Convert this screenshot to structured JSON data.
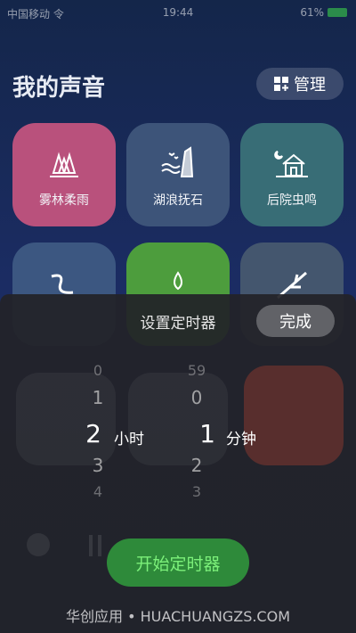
{
  "status": {
    "carrier": "中国移动 令",
    "time": "19:44",
    "battery": "61%"
  },
  "page": {
    "title": "我的声音",
    "manage_label": "管理"
  },
  "tiles": [
    {
      "label": "雾林柔雨",
      "icon": "forest-rain-icon",
      "color": "#b9517c"
    },
    {
      "label": "湖浪抚石",
      "icon": "lake-waves-icon",
      "color": "#3d5479"
    },
    {
      "label": "后院虫鸣",
      "icon": "backyard-house-icon",
      "color": "#386d76"
    },
    {
      "label": "",
      "icon": "river-icon",
      "color": "#3c5781"
    },
    {
      "label": "",
      "icon": "water-drop-icon",
      "color": "#4d9d3d"
    },
    {
      "label": "",
      "icon": "branch-icon",
      "color": "#44566e"
    }
  ],
  "timer": {
    "title": "设置定时器",
    "done_label": "完成",
    "hours": {
      "above2": "0",
      "above1": "1",
      "selected": "2",
      "below1": "3",
      "below2": "4",
      "unit": "小时"
    },
    "minutes": {
      "above2": "59",
      "above1": "0",
      "selected": "1",
      "below1": "2",
      "below2": "3",
      "unit": "分钟"
    },
    "start_label": "开始定时器"
  },
  "watermark": "华创应用 • HUACHUANGZS.COM"
}
